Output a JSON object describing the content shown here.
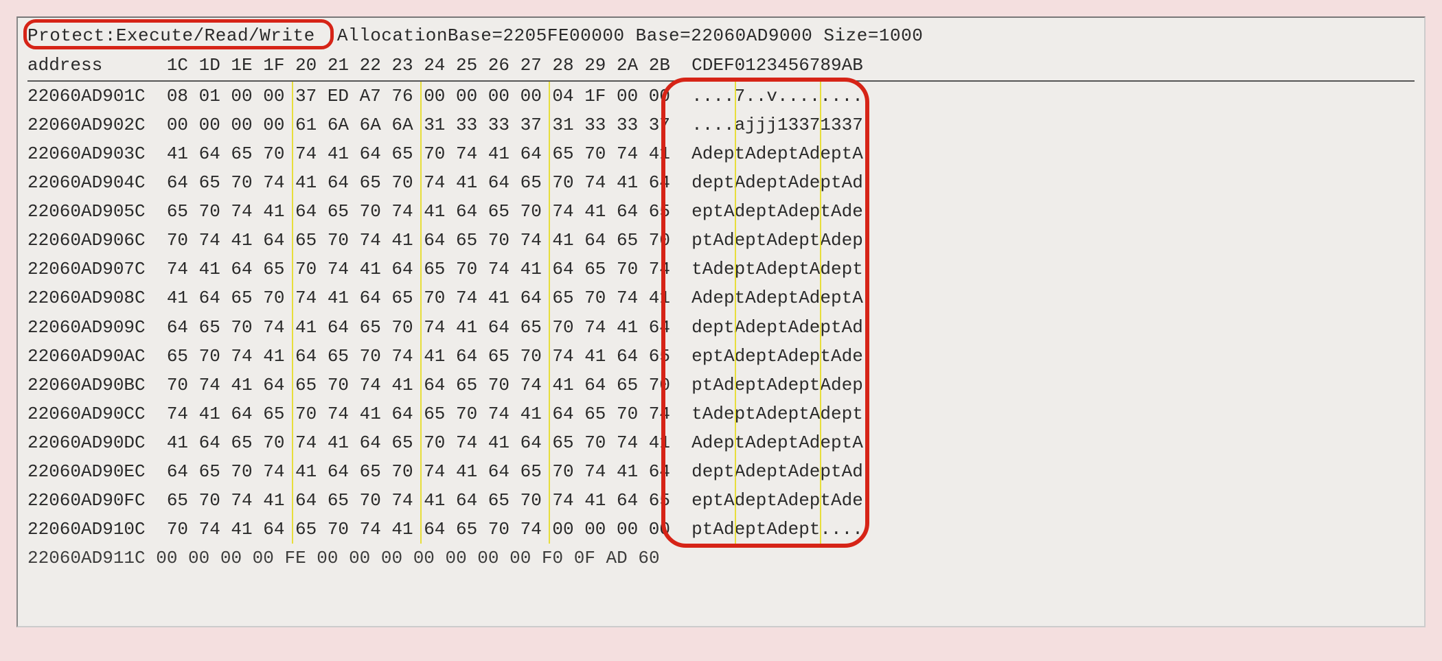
{
  "info": {
    "protect": "Protect:Execute/Read/Write",
    "alloc_base": "AllocationBase=2205FE00000",
    "base": "Base=22060AD9000",
    "size": "Size=1000"
  },
  "columns": {
    "address_label": "address",
    "hex": [
      "1C",
      "1D",
      "1E",
      "1F",
      "20",
      "21",
      "22",
      "23",
      "24",
      "25",
      "26",
      "27",
      "28",
      "29",
      "2A",
      "2B"
    ],
    "ascii_label": "CDEF0123456789AB"
  },
  "rows": [
    {
      "addr": "22060AD901C",
      "hex": [
        "08",
        "01",
        "00",
        "00",
        "37",
        "ED",
        "A7",
        "76",
        "00",
        "00",
        "00",
        "00",
        "04",
        "1F",
        "00",
        "00"
      ],
      "ascii": "....7..v........"
    },
    {
      "addr": "22060AD902C",
      "hex": [
        "00",
        "00",
        "00",
        "00",
        "61",
        "6A",
        "6A",
        "6A",
        "31",
        "33",
        "33",
        "37",
        "31",
        "33",
        "33",
        "37"
      ],
      "ascii": "....ajjj13371337"
    },
    {
      "addr": "22060AD903C",
      "hex": [
        "41",
        "64",
        "65",
        "70",
        "74",
        "41",
        "64",
        "65",
        "70",
        "74",
        "41",
        "64",
        "65",
        "70",
        "74",
        "41"
      ],
      "ascii": "AdeptAdeptAdeptA"
    },
    {
      "addr": "22060AD904C",
      "hex": [
        "64",
        "65",
        "70",
        "74",
        "41",
        "64",
        "65",
        "70",
        "74",
        "41",
        "64",
        "65",
        "70",
        "74",
        "41",
        "64"
      ],
      "ascii": "deptAdeptAdeptAd"
    },
    {
      "addr": "22060AD905C",
      "hex": [
        "65",
        "70",
        "74",
        "41",
        "64",
        "65",
        "70",
        "74",
        "41",
        "64",
        "65",
        "70",
        "74",
        "41",
        "64",
        "65"
      ],
      "ascii": "eptAdeptAdeptAde"
    },
    {
      "addr": "22060AD906C",
      "hex": [
        "70",
        "74",
        "41",
        "64",
        "65",
        "70",
        "74",
        "41",
        "64",
        "65",
        "70",
        "74",
        "41",
        "64",
        "65",
        "70"
      ],
      "ascii": "ptAdeptAdeptAdep"
    },
    {
      "addr": "22060AD907C",
      "hex": [
        "74",
        "41",
        "64",
        "65",
        "70",
        "74",
        "41",
        "64",
        "65",
        "70",
        "74",
        "41",
        "64",
        "65",
        "70",
        "74"
      ],
      "ascii": "tAdeptAdeptAdept"
    },
    {
      "addr": "22060AD908C",
      "hex": [
        "41",
        "64",
        "65",
        "70",
        "74",
        "41",
        "64",
        "65",
        "70",
        "74",
        "41",
        "64",
        "65",
        "70",
        "74",
        "41"
      ],
      "ascii": "AdeptAdeptAdeptA"
    },
    {
      "addr": "22060AD909C",
      "hex": [
        "64",
        "65",
        "70",
        "74",
        "41",
        "64",
        "65",
        "70",
        "74",
        "41",
        "64",
        "65",
        "70",
        "74",
        "41",
        "64"
      ],
      "ascii": "deptAdeptAdeptAd"
    },
    {
      "addr": "22060AD90AC",
      "hex": [
        "65",
        "70",
        "74",
        "41",
        "64",
        "65",
        "70",
        "74",
        "41",
        "64",
        "65",
        "70",
        "74",
        "41",
        "64",
        "65"
      ],
      "ascii": "eptAdeptAdeptAde"
    },
    {
      "addr": "22060AD90BC",
      "hex": [
        "70",
        "74",
        "41",
        "64",
        "65",
        "70",
        "74",
        "41",
        "64",
        "65",
        "70",
        "74",
        "41",
        "64",
        "65",
        "70"
      ],
      "ascii": "ptAdeptAdeptAdep"
    },
    {
      "addr": "22060AD90CC",
      "hex": [
        "74",
        "41",
        "64",
        "65",
        "70",
        "74",
        "41",
        "64",
        "65",
        "70",
        "74",
        "41",
        "64",
        "65",
        "70",
        "74"
      ],
      "ascii": "tAdeptAdeptAdept"
    },
    {
      "addr": "22060AD90DC",
      "hex": [
        "41",
        "64",
        "65",
        "70",
        "74",
        "41",
        "64",
        "65",
        "70",
        "74",
        "41",
        "64",
        "65",
        "70",
        "74",
        "41"
      ],
      "ascii": "AdeptAdeptAdeptA"
    },
    {
      "addr": "22060AD90EC",
      "hex": [
        "64",
        "65",
        "70",
        "74",
        "41",
        "64",
        "65",
        "70",
        "74",
        "41",
        "64",
        "65",
        "70",
        "74",
        "41",
        "64"
      ],
      "ascii": "deptAdeptAdeptAd"
    },
    {
      "addr": "22060AD90FC",
      "hex": [
        "65",
        "70",
        "74",
        "41",
        "64",
        "65",
        "70",
        "74",
        "41",
        "64",
        "65",
        "70",
        "74",
        "41",
        "64",
        "65"
      ],
      "ascii": "eptAdeptAdeptAde"
    },
    {
      "addr": "22060AD910C",
      "hex": [
        "70",
        "74",
        "41",
        "64",
        "65",
        "70",
        "74",
        "41",
        "64",
        "65",
        "70",
        "74",
        "00",
        "00",
        "00",
        "00"
      ],
      "ascii": "ptAdeptAdept...."
    }
  ],
  "partial_row": "22060AD911C 00 00 00 00 FE 00 00 00 00 00 00 00 F0 0F AD 60"
}
